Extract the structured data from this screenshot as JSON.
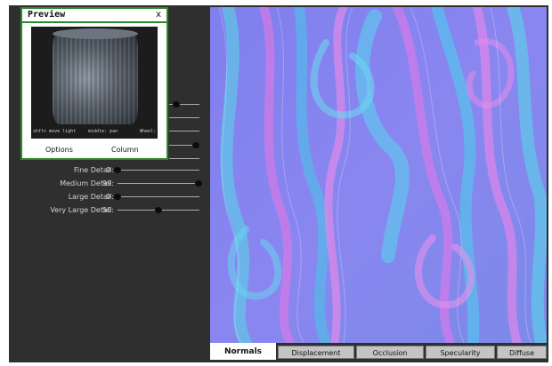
{
  "preview": {
    "title": "Preview",
    "close": "x",
    "hints": [
      "shft+ move light",
      "middle: pan",
      "Wheel:"
    ],
    "menu": [
      "Options",
      "Column"
    ]
  },
  "sliders": [
    {
      "label": "Fine Detail:",
      "value": "0",
      "level": 0.0
    },
    {
      "label": "Medium Detail:",
      "value": "99",
      "level": 0.99
    },
    {
      "label": "Large Detail:",
      "value": "0",
      "level": 0.0
    },
    {
      "label": "Very Large Detail:",
      "value": "50",
      "level": 0.5
    }
  ],
  "tabs": {
    "normals": "Normals",
    "displacement": "Displacement",
    "occlusion": "Occlusion",
    "specularity": "Specularity",
    "diffuse": "Diffuse"
  }
}
